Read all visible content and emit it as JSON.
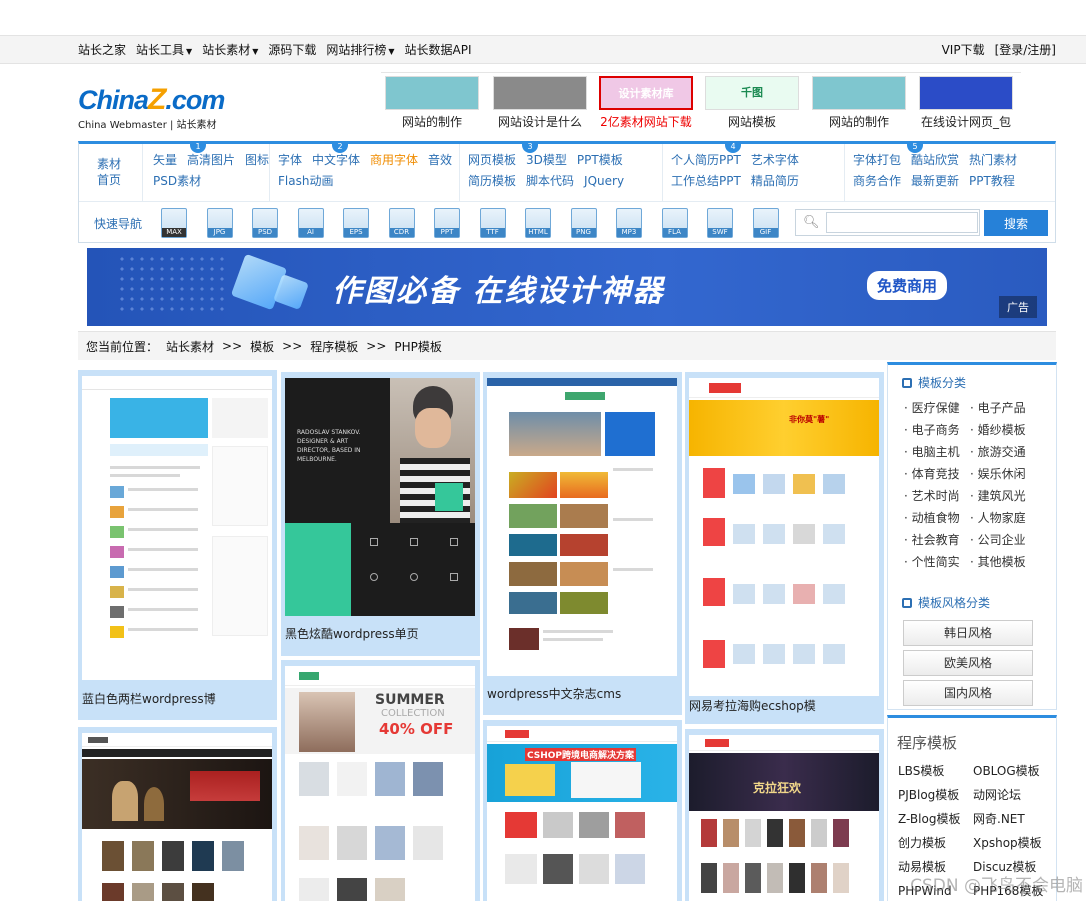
{
  "topnav": {
    "items": [
      {
        "label": "站长之家",
        "dropdown": false
      },
      {
        "label": "站长工具",
        "dropdown": true
      },
      {
        "label": "站长素材",
        "dropdown": true
      },
      {
        "label": "源码下载",
        "dropdown": false
      },
      {
        "label": "网站排行榜",
        "dropdown": true
      },
      {
        "label": "站长数据API",
        "dropdown": false
      }
    ],
    "vip": "VIP下载",
    "login": "[登录/注册]"
  },
  "logo": {
    "text_a": "China",
    "text_z": "Z",
    "text_b": ".com",
    "tagline": "China Webmaster  |  站长素材"
  },
  "banners": [
    {
      "caption": "网站的制作",
      "color": "#7fc6cf",
      "highlight": false
    },
    {
      "caption": "网站设计是什么",
      "color": "#8a8a8a",
      "highlight": false
    },
    {
      "caption": "2亿素材网站下载",
      "color": "#f0c8e6",
      "highlight": true,
      "inner": "设计素材库"
    },
    {
      "caption": "网站模板",
      "color": "#e9fbf1",
      "highlight": false,
      "inner": "千图"
    },
    {
      "caption": "网站的制作",
      "color": "#7fc6cf",
      "highlight": false
    },
    {
      "caption": "在线设计网页_包",
      "color": "#2b4cc7",
      "highlight": false
    }
  ],
  "catnav": {
    "home": "素材首页",
    "groups": [
      {
        "num": "1",
        "links": [
          {
            "t": "矢量",
            "hot": false
          },
          {
            "t": "高清图片",
            "hot": false
          },
          {
            "t": "图标",
            "hot": false
          },
          {
            "t": "PSD素材",
            "hot": false
          }
        ]
      },
      {
        "num": "2",
        "links": [
          {
            "t": "字体",
            "hot": false
          },
          {
            "t": "中文字体",
            "hot": false
          },
          {
            "t": "商用字体",
            "hot": true
          },
          {
            "t": "音效",
            "hot": false
          },
          {
            "t": "Flash动画",
            "hot": false
          }
        ]
      },
      {
        "num": "3",
        "links": [
          {
            "t": "网页模板",
            "hot": false
          },
          {
            "t": "3D模型",
            "hot": false
          },
          {
            "t": "PPT模板",
            "hot": false
          },
          {
            "t": "简历模板",
            "hot": false
          },
          {
            "t": "脚本代码",
            "hot": false
          },
          {
            "t": "JQuery",
            "hot": false
          }
        ]
      },
      {
        "num": "4",
        "links": [
          {
            "t": "个人简历PPT",
            "hot": false
          },
          {
            "t": "艺术字体",
            "hot": false
          },
          {
            "t": "工作总结PPT",
            "hot": false
          },
          {
            "t": "精品简历",
            "hot": false
          }
        ]
      },
      {
        "num": "5",
        "links": [
          {
            "t": "字体打包",
            "hot": false
          },
          {
            "t": "酷站欣赏",
            "hot": false
          },
          {
            "t": "热门素材",
            "hot": false
          },
          {
            "t": "商务合作",
            "hot": false
          },
          {
            "t": "最新更新",
            "hot": false
          },
          {
            "t": "PPT教程",
            "hot": false
          }
        ]
      }
    ],
    "quicknav": "快速导航",
    "filetypes": [
      "MAX",
      "JPG",
      "PSD",
      "AI",
      "EPS",
      "CDR",
      "PPT",
      "TTF",
      "HTML",
      "PNG",
      "MP3",
      "FLA",
      "SWF",
      "GIF"
    ],
    "search_button": "搜索",
    "search_value": ""
  },
  "ad": {
    "slogan": "作图必备  在线设计神器",
    "badge": "免费商用",
    "tag": "广告"
  },
  "breadcrumb": {
    "prefix": "您当前位置：",
    "items": [
      "站长素材",
      ">>",
      "模板",
      ">>",
      "程序模板",
      ">>",
      "PHP模板"
    ]
  },
  "cards": [
    {
      "caption": "蓝白色两栏wordpress博"
    },
    {
      "caption": "黑色炫酷wordpress单页"
    },
    {
      "caption": "wordpress中文杂志cms"
    },
    {
      "caption": "网易考拉海购ecshop模"
    }
  ],
  "card_previews": {
    "c2_text": "RADOSLAV STANKOV. DESIGNER & ART DIRECTOR, BASED IN MELBOURNE.",
    "c6_summer": "SUMMER",
    "c6_collection": "COLLECTION",
    "c6_off": "40% OFF",
    "c7_header": "CSHOP跨境电商解决方案",
    "c8_banner": "克拉狂欢",
    "c4_banner": "非你莫\"薯\""
  },
  "sidebar": {
    "category_title": "模板分类",
    "categories": [
      "医疗保健",
      "电子产品",
      "电子商务",
      "婚纱模板",
      "电脑主机",
      "旅游交通",
      "体育竞技",
      "娱乐休闲",
      "艺术时尚",
      "建筑风光",
      "动植食物",
      "人物家庭",
      "社会教育",
      "公司企业",
      "个性简实",
      "其他模板"
    ],
    "style_title": "模板风格分类",
    "styles": [
      "韩日风格",
      "欧美风格",
      "国内风格"
    ],
    "program_title": "程序模板",
    "programs": [
      "LBS模板",
      "OBLOG模板",
      "PJBlog模板",
      "动网论坛",
      "Z-Blog模板",
      "网奇.NET",
      "创力模板",
      "Xpshop模板",
      "动易模板",
      "Discuz模板",
      "PHPWind",
      "PHP168模板"
    ]
  },
  "watermark": "CSDN @飞鸟不会电脑"
}
